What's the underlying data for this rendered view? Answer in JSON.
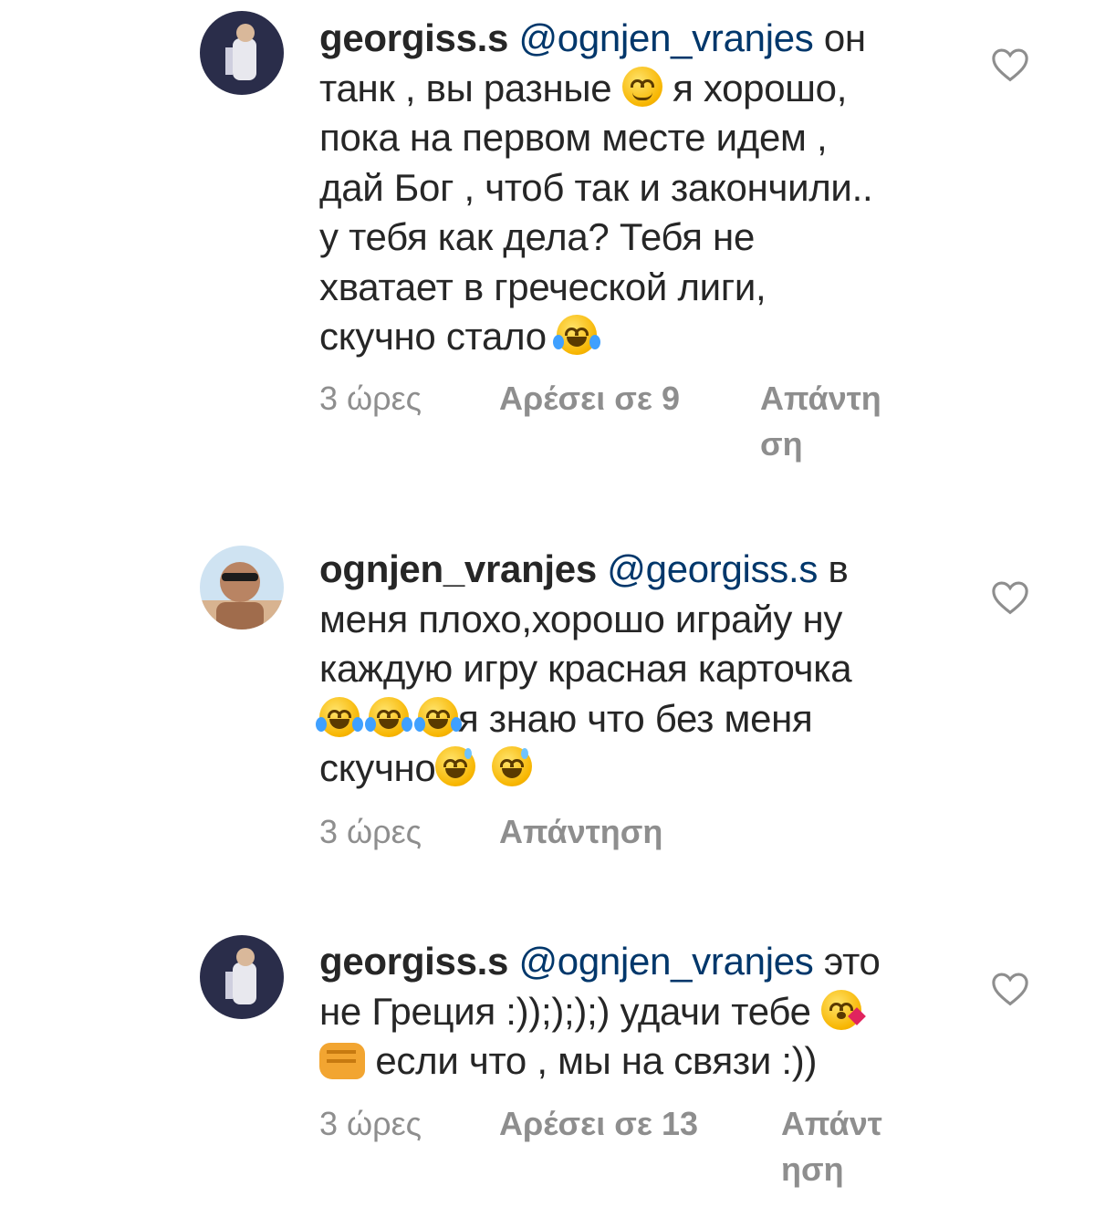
{
  "comments": [
    {
      "username": "georgiss.s",
      "mention": "@ognjen_vranjes",
      "lines": [
        {
          "before": "он"
        },
        {
          "before": "танк , вы разные",
          "emoji": "smiling-face-icon",
          "after": "я хорошо,"
        },
        {
          "before": "пока на первом месте идем ,"
        },
        {
          "before": "дай Бог , чтоб так и закончили.."
        },
        {
          "before": "у тебя как дела? Тебя не"
        },
        {
          "before": "хватает в греческой лиги,"
        },
        {
          "before": "скучно стало",
          "emoji": "tears-of-joy-icon"
        }
      ],
      "time": "3 ώρες",
      "likes": "Αρέσει σε 9",
      "reply": "Απάντηση"
    },
    {
      "username": "ognjen_vranjes",
      "mention": "@georgiss.s",
      "lines": [
        {
          "before": "в"
        },
        {
          "before": "меня плохо,хорошо играйу ну"
        },
        {
          "before": "каждую игру красная карточка"
        },
        {
          "before": "",
          "emoji": "tears-of-joy-icon x3",
          "after": "я знаю что без меня"
        },
        {
          "before": "скучно",
          "emoji": "grinning-sweat-icon x2"
        }
      ],
      "time": "3 ώρες",
      "reply": "Απάντηση"
    },
    {
      "username": "georgiss.s",
      "mention": "@ognjen_vranjes",
      "lines": [
        {
          "before": "это"
        },
        {
          "before": "не Греция :));););) удачи тебе",
          "emoji": "face-blowing-kiss-icon"
        },
        {
          "before": "",
          "emoji": "fist-icon",
          "after": "если что , мы на связи :))"
        }
      ],
      "time": "3 ώρες",
      "likes": "Αρέσει σε 13",
      "reply": "Απάντηση"
    }
  ],
  "colors": {
    "text": "#262626",
    "mention": "#00376b",
    "meta": "#8e8e8e",
    "heart": "#8e8e8e"
  }
}
